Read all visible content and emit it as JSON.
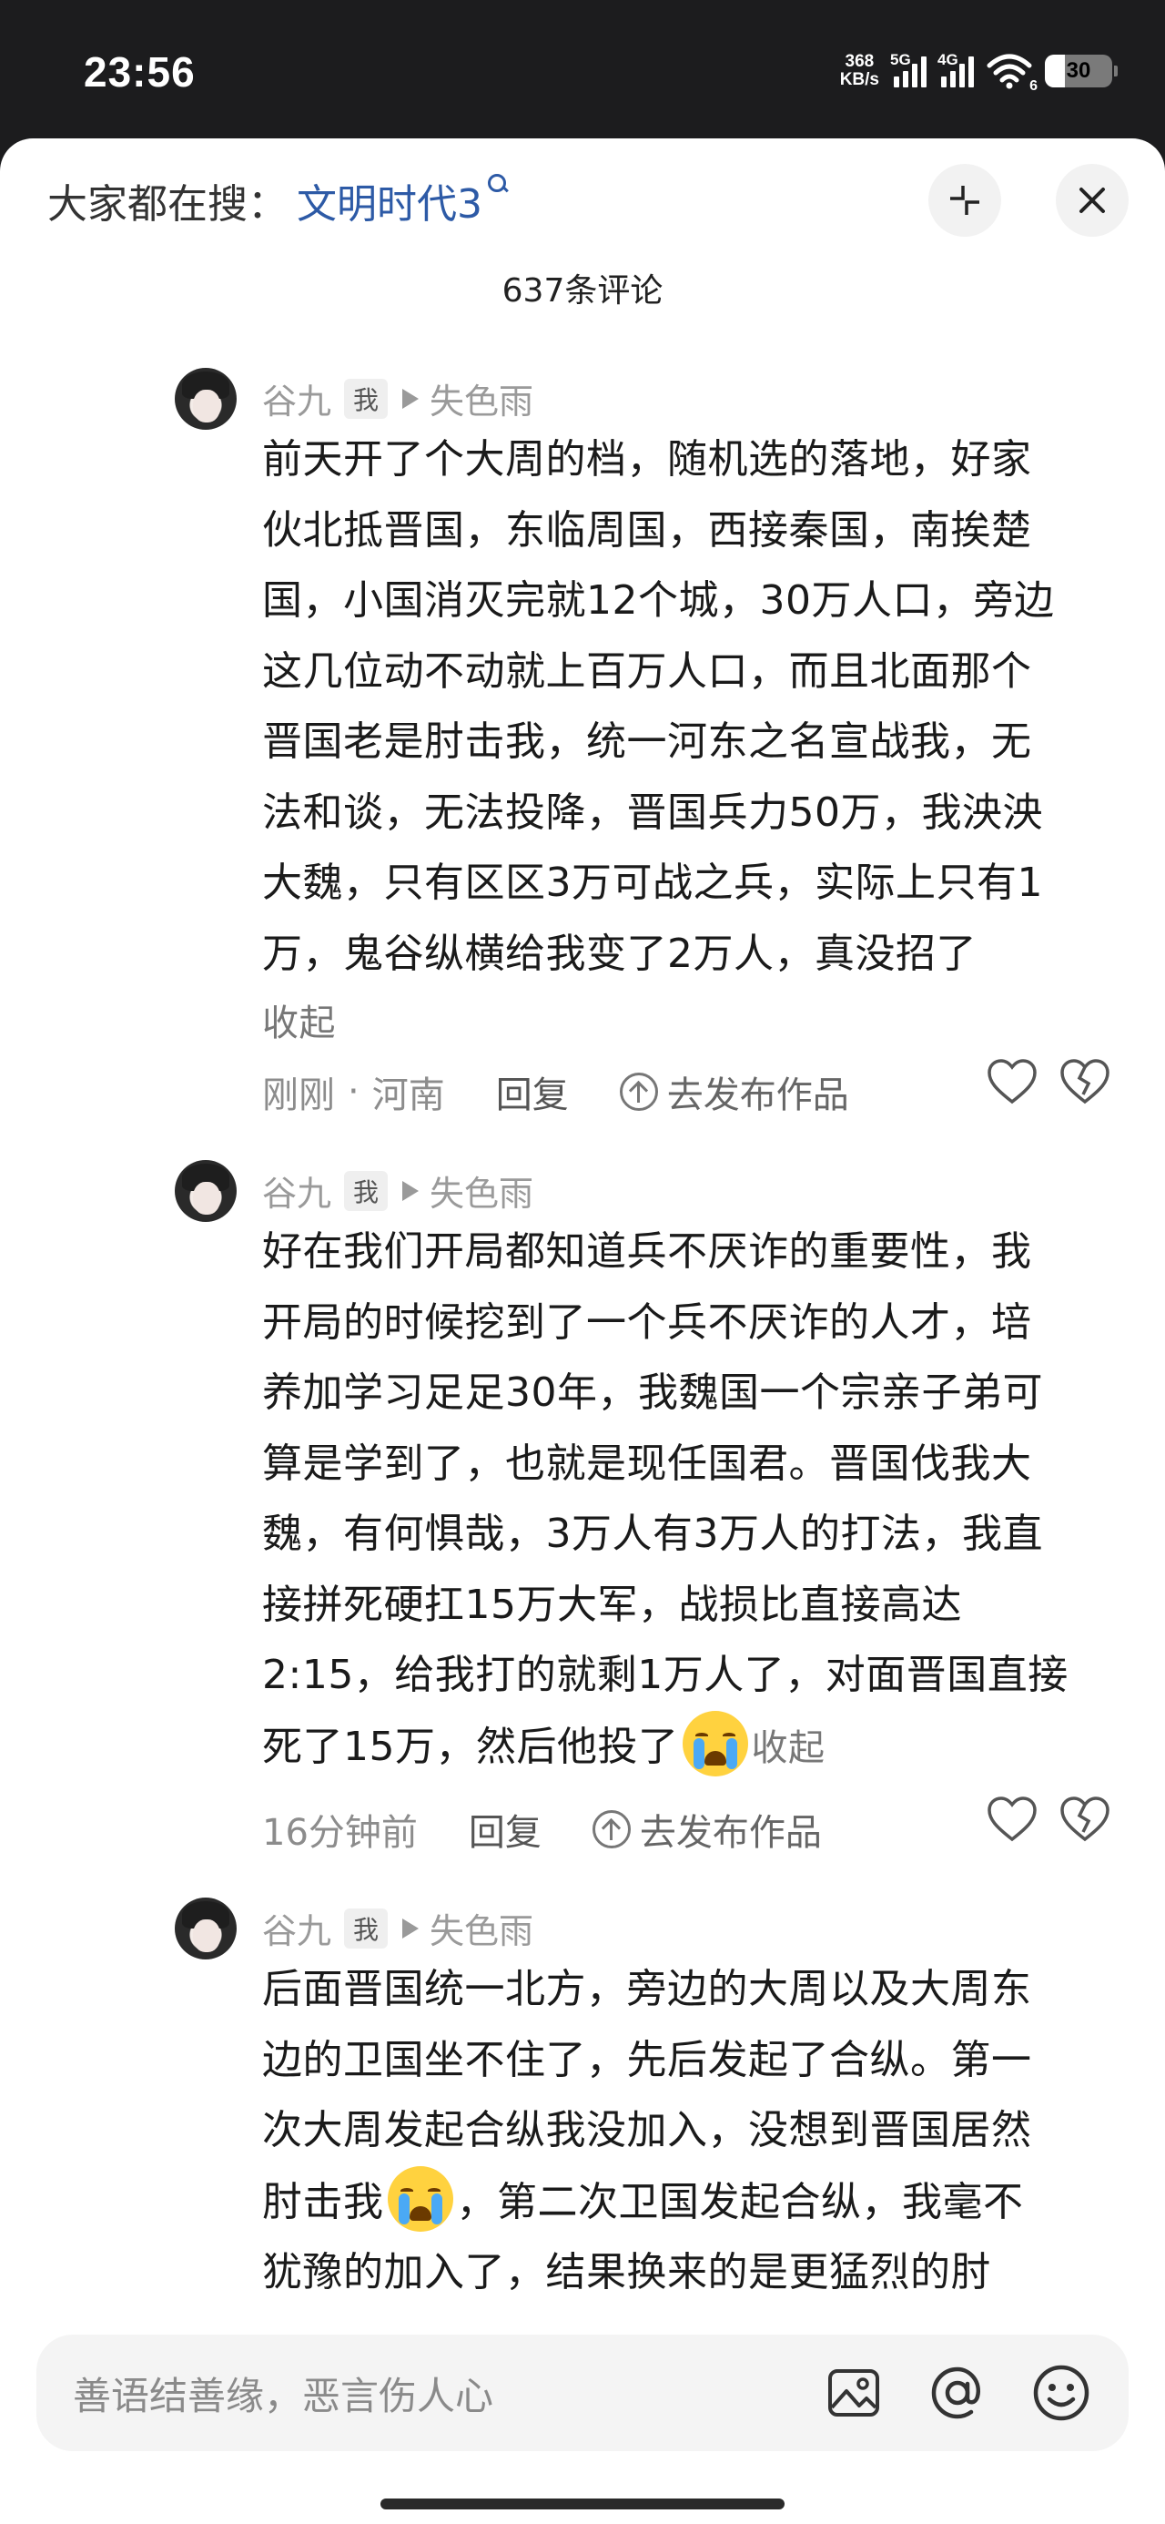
{
  "status_bar": {
    "time": "23:56",
    "net_speed_top": "368",
    "net_speed_bottom": "KB/s",
    "sim1": "5G",
    "sim2": "4G",
    "wifi_badge": "6",
    "battery": "30",
    "battery_level": 0.3
  },
  "header": {
    "hot_search_label": "大家都在搜：",
    "hot_search_keyword": "文明时代3",
    "collapse_icon": "collapse-icon",
    "close_icon": "close-icon",
    "comment_count": "637条评论"
  },
  "comments": [
    {
      "author": "谷九",
      "me_badge": "我",
      "reply_to": "失色雨",
      "lines": [
        "前天开了个大周的档，随机选的落地，好家",
        "伙北抵晋国，东临周国，西接秦国，南挨楚",
        "国，小国消灭完就12个城，30万人口，旁边",
        "这几位动不动就上百万人口，而且北面那个",
        "晋国老是肘击我，统一河东之名宣战我，无",
        "法和谈，无法投降，晋国兵力50万，我泱泱",
        "大魏，只有区区3万可战之兵，实际上只有1",
        "万，鬼谷纵横给我变了2万人，真没招了"
      ],
      "collapse": "收起",
      "time": "刚刚",
      "location": "河南",
      "reply": "回复",
      "publish": "去发布作品"
    },
    {
      "author": "谷九",
      "me_badge": "我",
      "reply_to": "失色雨",
      "lines": [
        "好在我们开局都知道兵不厌诈的重要性，我",
        "开局的时候挖到了一个兵不厌诈的人才，培",
        "养加学习足足30年，我魏国一个宗亲子弟可",
        "算是学到了，也就是现任国君。晋国伐我大",
        "魏，有何惧哉，3万人有3万人的打法，我直",
        "接拼死硬扛15万大军，战损比直接高达",
        "2:15，给我打的就剩1万人了，对面晋国直接"
      ],
      "last_line": "死了15万，然后他投了",
      "collapse": "收起",
      "time": "16分钟前",
      "reply": "回复",
      "publish": "去发布作品"
    },
    {
      "author": "谷九",
      "me_badge": "我",
      "reply_to": "失色雨",
      "lines": [
        "后面晋国统一北方，旁边的大周以及大周东",
        "边的卫国坐不住了，先后发起了合纵。第一",
        "次大周发起合纵我没加入，没想到晋国居然"
      ],
      "line4_a": "肘击我",
      "line4_b": "，第二次卫国发起合纵，我毫不",
      "line5": "犹豫的加入了，结果换来的是更猛烈的肘"
    }
  ],
  "input": {
    "placeholder": "善语结善缘，恶言伤人心",
    "image_icon": "image-icon",
    "at_icon": "at-icon",
    "emoji_icon": "emoji-icon"
  }
}
